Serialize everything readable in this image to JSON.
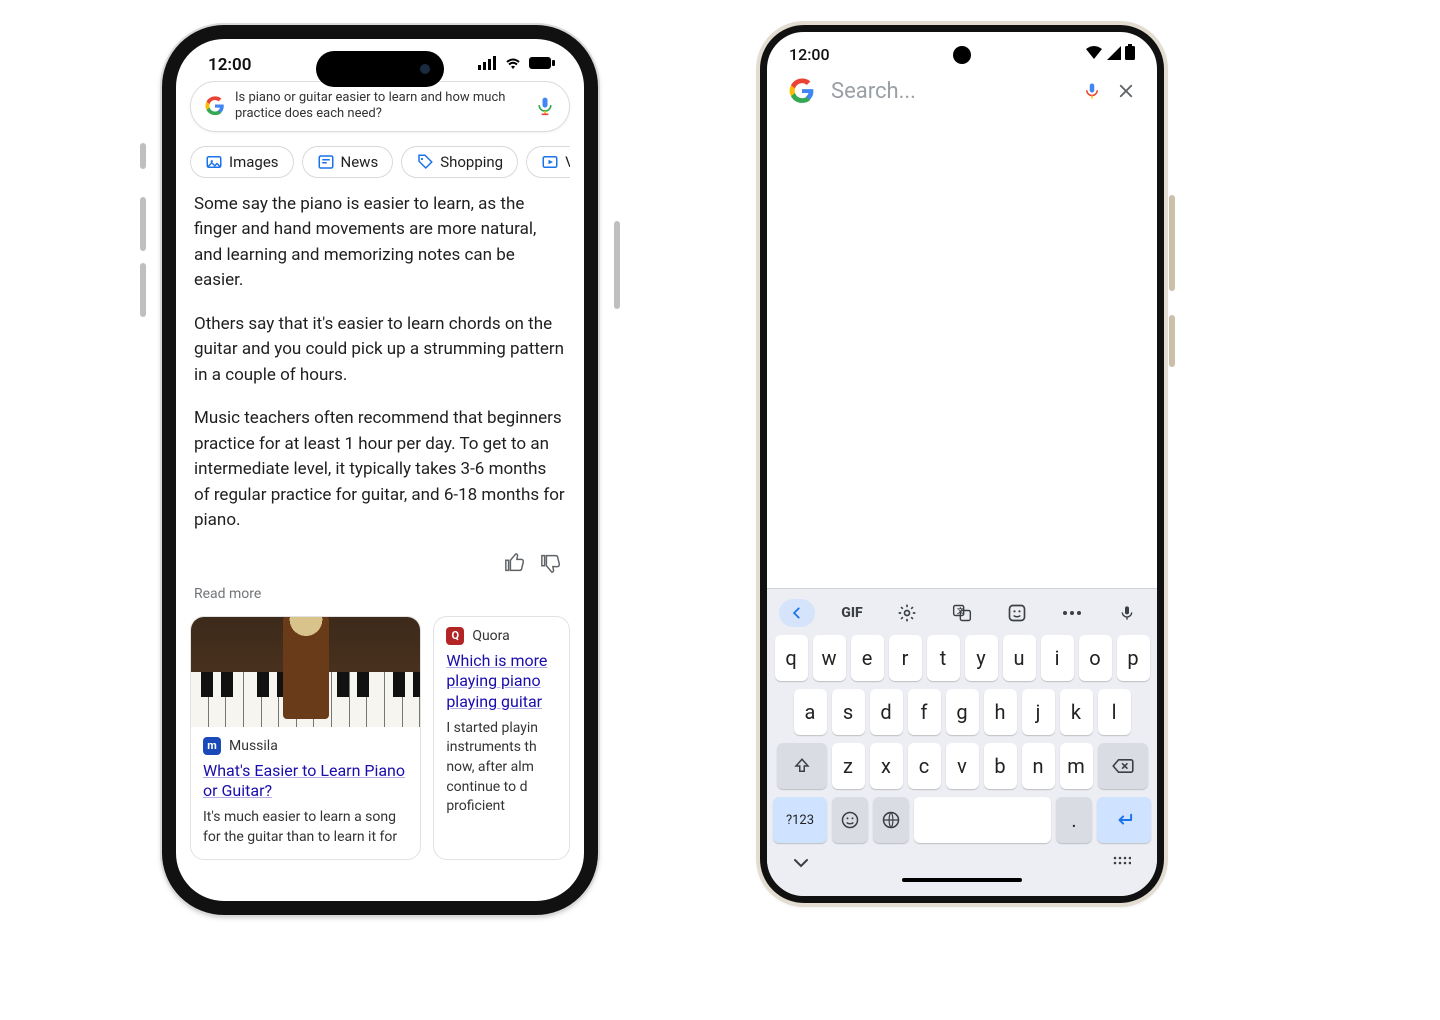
{
  "iphone": {
    "time": "12:00",
    "search_query": "Is piano or guitar easier to learn and how much practice does each need?",
    "chips": [
      "Images",
      "News",
      "Shopping",
      "Vide"
    ],
    "answer_paragraphs": [
      "Some say the piano is easier to learn, as the finger and hand movements are more natural, and learning and memorizing notes can be easier.",
      "Others say that it's easier to learn chords on the guitar and you could pick up a strumming pattern in a couple of hours.",
      "Music teachers often recommend that beginners practice for at least 1 hour per day. To get to an intermediate level, it typically takes 3-6 months of regular practice for guitar, and 6-18 months for piano."
    ],
    "read_more": "Read more",
    "cards": [
      {
        "source": "Mussila",
        "title": "What's Easier to Learn Piano or Guitar?",
        "snippet": "It's much easier to learn a song for the guitar than to learn it for"
      },
      {
        "source": "Quora",
        "title": "Which is more playing piano playing guitar",
        "snippet": "I started playin instruments th now, after alm continue to d proficient"
      }
    ]
  },
  "android": {
    "time": "12:00",
    "placeholder": "Search...",
    "kbd_toolbar_gif": "GIF",
    "rows": [
      [
        "q",
        "w",
        "e",
        "r",
        "t",
        "y",
        "u",
        "i",
        "o",
        "p"
      ],
      [
        "a",
        "s",
        "d",
        "f",
        "g",
        "h",
        "j",
        "k",
        "l"
      ],
      [
        "z",
        "x",
        "c",
        "v",
        "b",
        "n",
        "m"
      ]
    ],
    "numsym": "?123",
    "dot": "."
  }
}
